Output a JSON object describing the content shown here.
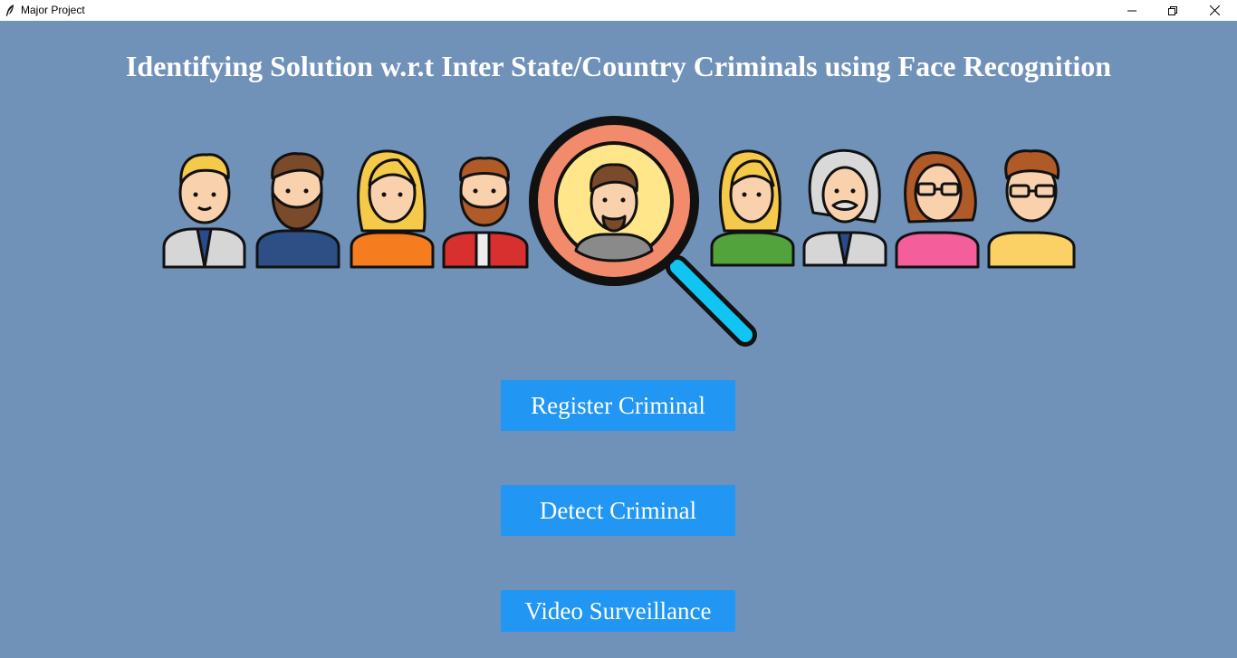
{
  "window": {
    "title": "Major Project",
    "icon": "feather-icon",
    "controls": [
      "minimize-icon",
      "maximize-icon",
      "close-icon"
    ]
  },
  "header": {
    "title": "Identifying Solution w.r.t Inter State/Country Criminals using Face Recognition"
  },
  "banner": {
    "description_icons": [
      "person-avatar-icon",
      "magnifying-glass-icon"
    ]
  },
  "buttons": {
    "register": "Register Criminal",
    "detect": "Detect Criminal",
    "video": "Video Surveillance"
  },
  "colors": {
    "background": "#7092b8",
    "button": "#2196f3",
    "button_text": "#ffffff",
    "title_text": "#ffffff"
  }
}
